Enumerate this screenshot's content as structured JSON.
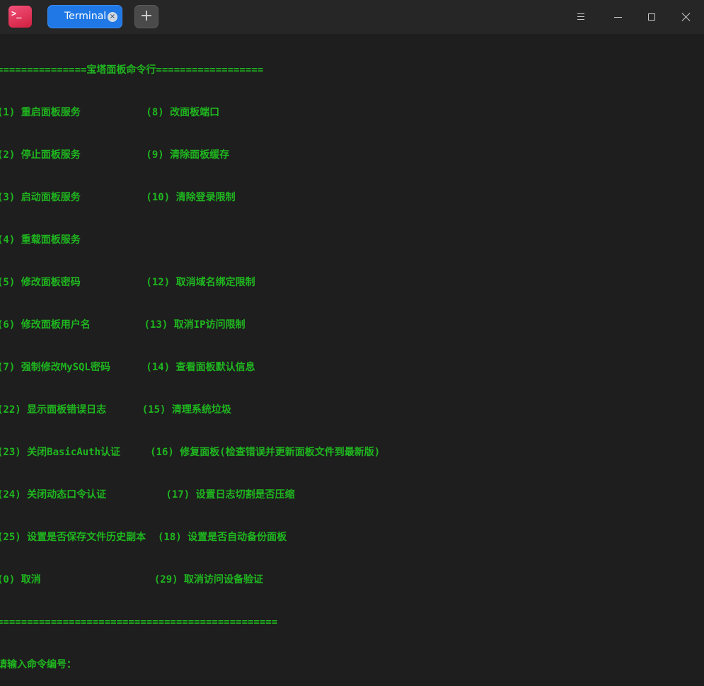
{
  "window": {
    "tab_label": "Terminal",
    "tab_close_glyph": "×",
    "add_tab_glyph": "+",
    "app_icon_glyph": ">_"
  },
  "colors": {
    "terminal_bg": "#1e1e1e",
    "terminal_text": "#1fb61f",
    "tab_active": "#1f78e6",
    "titlebar_bg": "#262626"
  },
  "icons": {
    "app": "terminal-app-icon",
    "menu": "hamburger-menu-icon",
    "minimize": "minimize-icon",
    "maximize": "maximize-icon",
    "close": "close-icon"
  },
  "terminal": {
    "lines": [
      "===============宝塔面板命令行==================",
      "(1) 重启面板服务           (8) 改面板端口",
      "(2) 停止面板服务           (9) 清除面板缓存",
      "(3) 启动面板服务           (10) 清除登录限制",
      "(4) 重载面板服务",
      "(5) 修改面板密码           (12) 取消域名绑定限制",
      "(6) 修改面板用户名         (13) 取消IP访问限制",
      "(7) 强制修改MySQL密码      (14) 查看面板默认信息",
      "(22) 显示面板错误日志      (15) 清理系统垃圾",
      "(23) 关闭BasicAuth认证     (16) 修复面板(检查错误并更新面板文件到最新版)",
      "(24) 关闭动态口令认证          (17) 设置日志切割是否压缩",
      "(25) 设置是否保存文件历史副本  (18) 设置是否自动备份面板",
      "(0) 取消                   (29) 取消访问设备验证",
      "===============================================",
      "请输入命令编号："
    ]
  }
}
